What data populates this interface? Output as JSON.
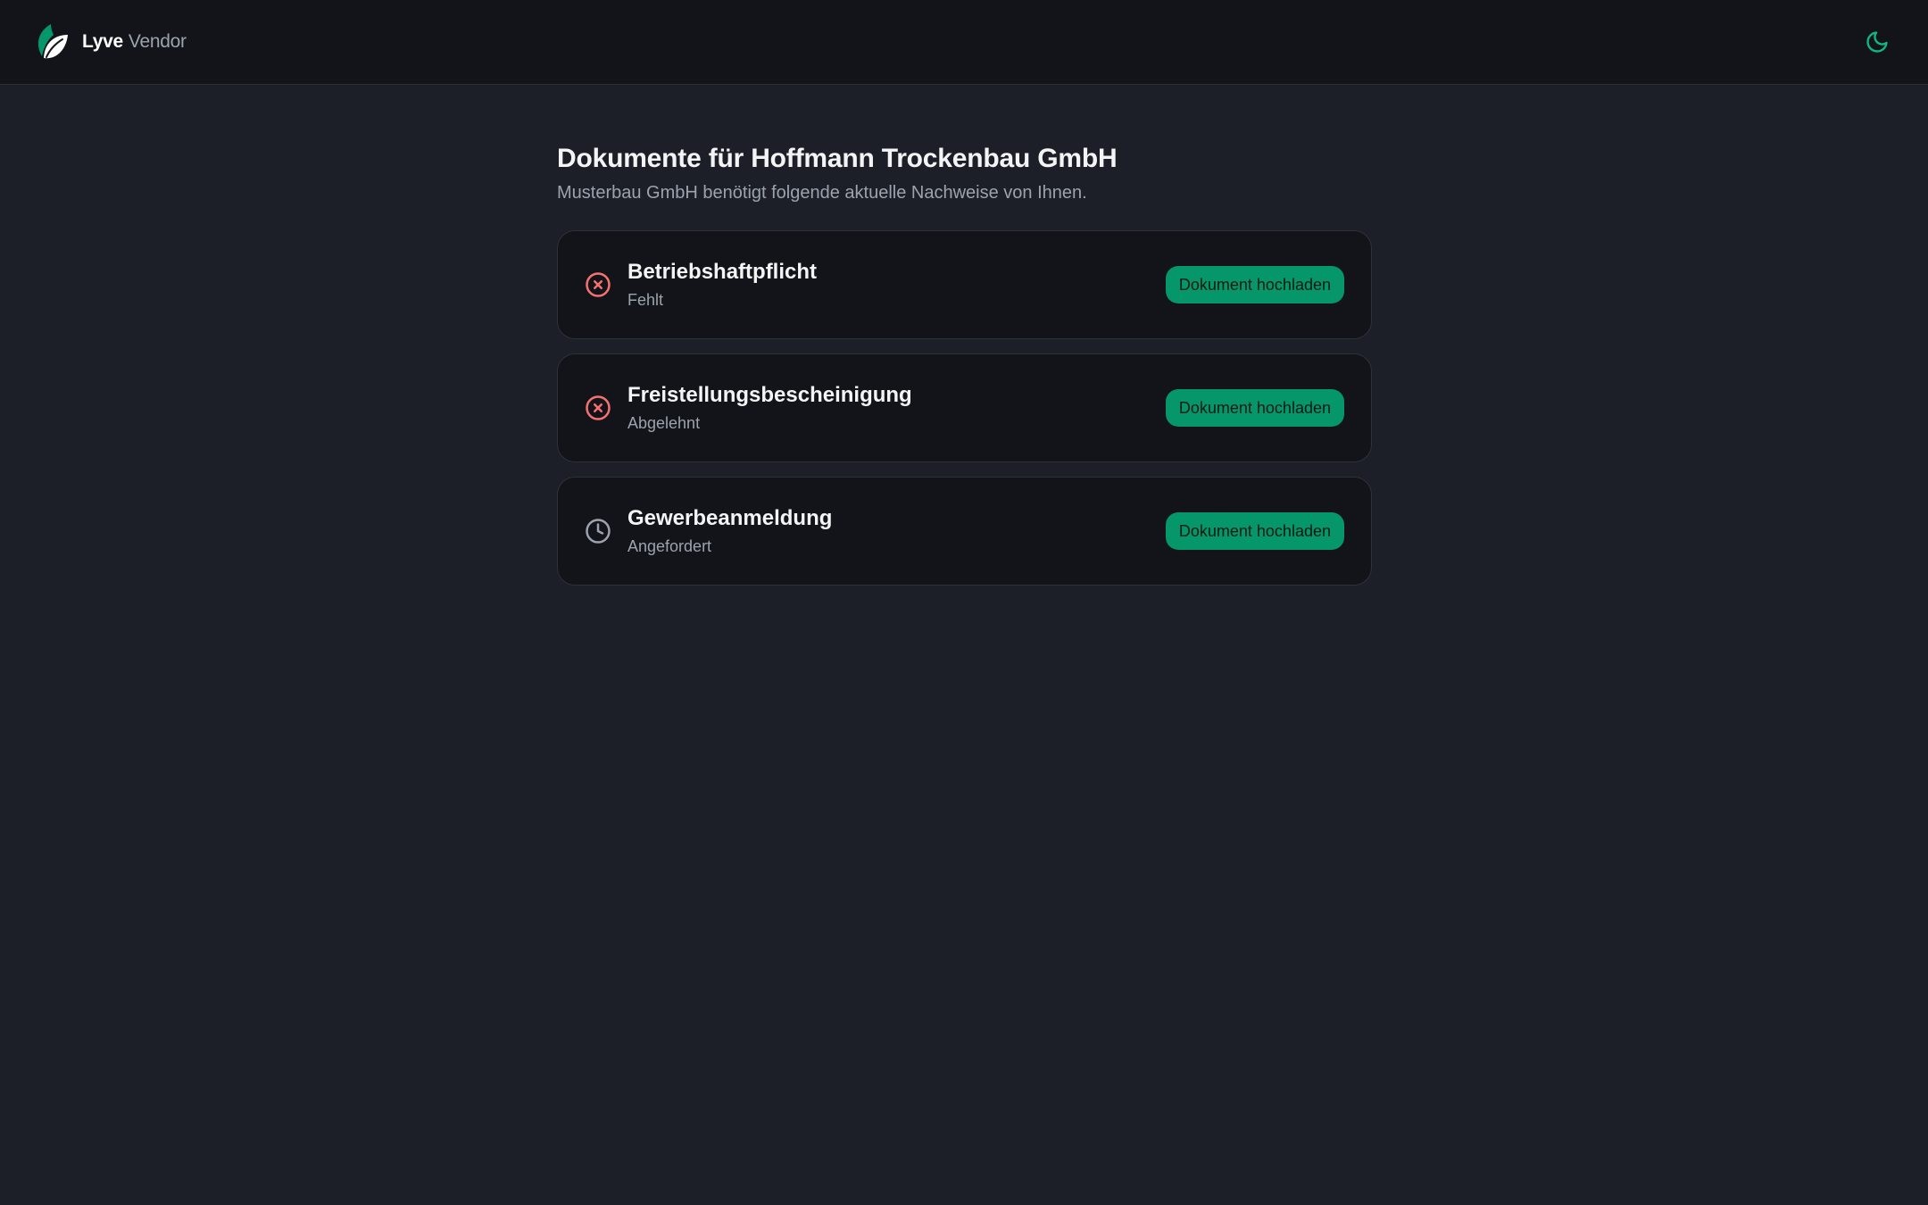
{
  "header": {
    "brand_name": "Lyve",
    "brand_suffix": "Vendor",
    "logo_icon": "leaf-icon",
    "theme_toggle_icon": "moon-icon"
  },
  "page": {
    "title": "Dokumente für Hoffmann Trockenbau GmbH",
    "subtitle": "Musterbau GmbH benötigt folgende aktuelle Nachweise von Ihnen."
  },
  "documents": [
    {
      "title": "Betriebshaftpflicht",
      "status": "Fehlt",
      "icon": "x-circle-icon",
      "button_label": "Dokument hochladen"
    },
    {
      "title": "Freistellungsbescheinigung",
      "status": "Abgelehnt",
      "icon": "x-circle-icon",
      "button_label": "Dokument hochladen"
    },
    {
      "title": "Gewerbeanmeldung",
      "status": "Angefordert",
      "icon": "clock-icon",
      "button_label": "Dokument hochladen"
    }
  ],
  "colors": {
    "accent": "#059669",
    "error": "#f87171",
    "pending": "#9ca3af",
    "background": "#1c1f27",
    "card": "#121419"
  }
}
